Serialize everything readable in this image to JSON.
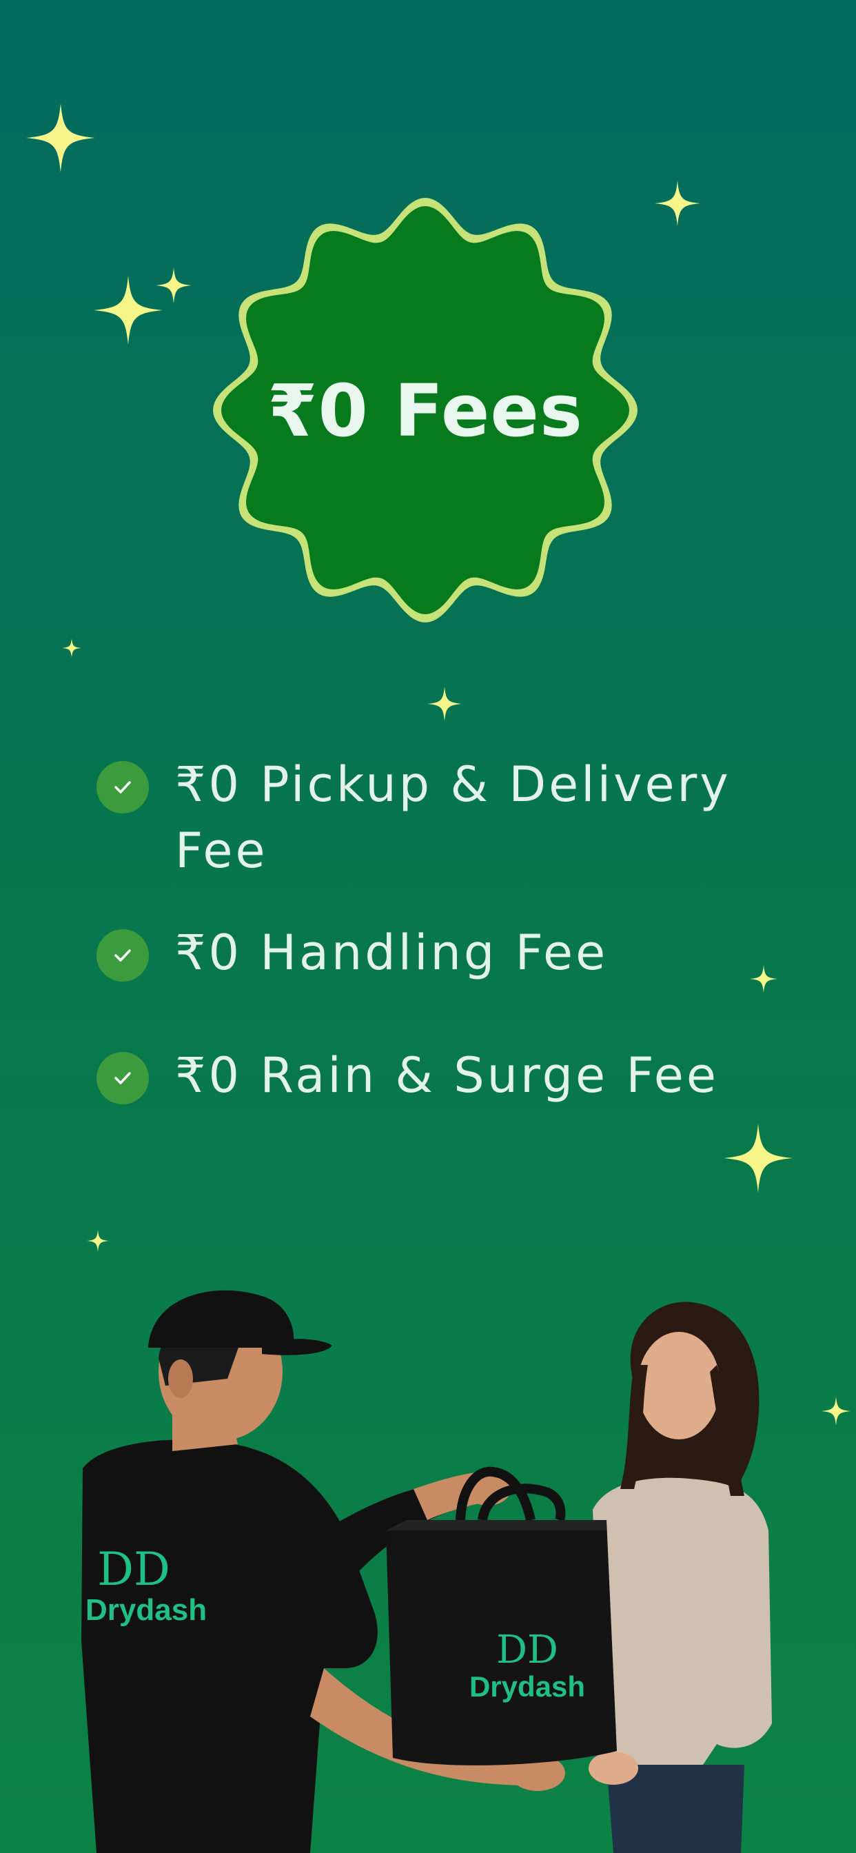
{
  "badge": {
    "title": "₹0 Fees",
    "fill_color": "#067a1c",
    "ring_color": "#c8e27a"
  },
  "features": [
    {
      "icon": "check-icon",
      "text": "₹0 Pickup & Delivery Fee"
    },
    {
      "icon": "check-icon",
      "text": "₹0 Handling Fee"
    },
    {
      "icon": "check-icon",
      "text": "₹0 Rain & Surge Fee"
    }
  ],
  "illustration": {
    "brand_shirt": "Drydash",
    "brand_bag": "Drydash",
    "brand_mark": "DD"
  },
  "colors": {
    "background_top": "#036b5f",
    "background_bottom": "#0d8245",
    "sparkle": "#f6f58a",
    "check": "#3c9b3c",
    "brand": "#1fbf86"
  }
}
